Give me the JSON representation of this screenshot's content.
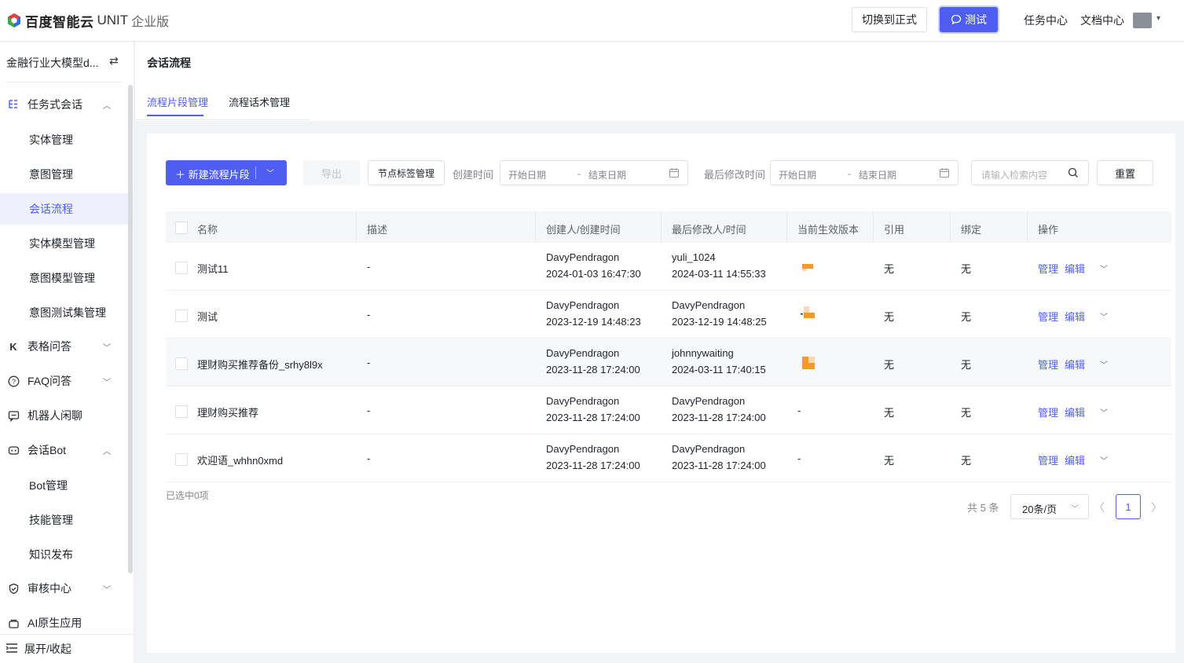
{
  "header": {
    "brand": "百度智能云",
    "product": "UNIT",
    "edition": "企业版",
    "switch_label": "切换到正式",
    "test_label": "测试",
    "nav": [
      "任务中心",
      "文档中心"
    ]
  },
  "sidebar": {
    "project": "金融行业大模型d...",
    "groups": [
      {
        "label": "任务式会话",
        "icon": "task-tree-icon",
        "expanded": true,
        "children": [
          "实体管理",
          "意图管理",
          "会话流程",
          "实体模型管理",
          "意图模型管理",
          "意图测试集管理"
        ]
      },
      {
        "label": "表格问答",
        "icon": "table-qa-icon",
        "expanded": false
      },
      {
        "label": "FAQ问答",
        "icon": "question-circle-icon",
        "expanded": false
      },
      {
        "label": "机器人闲聊",
        "icon": "chat-bubble-icon"
      },
      {
        "label": "会话Bot",
        "icon": "bot-icon",
        "expanded": true,
        "children": [
          "Bot管理",
          "技能管理",
          "知识发布"
        ]
      },
      {
        "label": "审核中心",
        "icon": "shield-check-icon",
        "expanded": false
      },
      {
        "label": "AI原生应用",
        "icon": "app-box-icon"
      }
    ],
    "active_item": "会话流程",
    "footer_label": "展开/收起"
  },
  "page": {
    "title": "会话流程",
    "tabs": [
      "流程片段管理",
      "流程话术管理"
    ],
    "active_tab": "流程片段管理"
  },
  "toolbar": {
    "new_label": "新建流程片段",
    "export_label": "导出",
    "tags_label": "节点标签管理",
    "created_label": "创建时间",
    "modified_label": "最后修改时间",
    "start_placeholder": "开始日期",
    "end_placeholder": "结束日期",
    "range_sep": "-",
    "search_placeholder": "请输入检索内容",
    "reset_label": "重置"
  },
  "table": {
    "columns": [
      "名称",
      "描述",
      "创建人/创建时间",
      "最后修改人/时间",
      "当前生效版本",
      "引用",
      "绑定",
      "操作"
    ],
    "rows": [
      {
        "name": "测试11",
        "desc": "-",
        "creator": "DavyPendragon",
        "created": "2024-01-03 16:47:30",
        "modifier": "yuli_1024",
        "modified": "2024-03-11 14:55:33",
        "version": "thumb",
        "ref": "无",
        "bind": "无"
      },
      {
        "name": "测试",
        "desc": "-",
        "creator": "DavyPendragon",
        "created": "2023-12-19 14:48:23",
        "modifier": "DavyPendragon",
        "modified": "2023-12-19 14:48:25",
        "version": "thumb",
        "ref": "无",
        "bind": "无"
      },
      {
        "name": "理财购买推荐备份_srhy8l9x",
        "desc": "-",
        "creator": "DavyPendragon",
        "created": "2023-11-28 17:24:00",
        "modifier": "johnnywaiting",
        "modified": "2024-03-11 17:40:15",
        "version": "thumb",
        "ref": "无",
        "bind": "无"
      },
      {
        "name": "理财购买推荐",
        "desc": "-",
        "creator": "DavyPendragon",
        "created": "2023-11-28 17:24:00",
        "modifier": "DavyPendragon",
        "modified": "2023-11-28 17:24:00",
        "version": "-",
        "ref": "无",
        "bind": "无"
      },
      {
        "name": "欢迎语_whhn0xmd",
        "desc": "-",
        "creator": "DavyPendragon",
        "created": "2023-11-28 17:24:00",
        "modifier": "DavyPendragon",
        "modified": "2023-11-28 17:24:00",
        "version": "-",
        "ref": "无",
        "bind": "无"
      }
    ],
    "action_manage": "管理",
    "action_edit": "编辑"
  },
  "footer": {
    "selected": "已选中0项",
    "total": "共 5 条",
    "page_size": "20条/页",
    "current_page": "1"
  },
  "colors": {
    "accent": "#4d5ef0",
    "version_thumb": "#f39a2e"
  }
}
